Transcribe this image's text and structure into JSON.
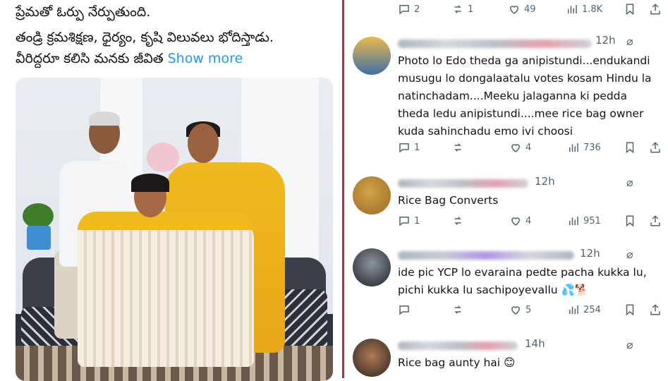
{
  "post": {
    "line1": "ప్రేమతో ఓర్పు నేర్పుతుంది.",
    "line2": "తండ్రి క్రమశిక్షణ, ధైర్యం, కృషి విలువలు భోదిస్తాడు.",
    "line3": "వీరిద్దరూ కలిసి మనకు జీవిత",
    "show_more": "Show more",
    "photo_alt": "family photo on sofa"
  },
  "top_actions": {
    "replies": "2",
    "reposts": "1",
    "likes": "49",
    "views": "1.8K"
  },
  "replies": [
    {
      "time": "12h",
      "text": "Photo lo Edo theda ga anipistundi...endukandi musugu lo dongalaatalu votes kosam Hindu la natinchadam....Meeku jalaganna ki pedda theda ledu anipistundi....mee rice bag owner kuda sahinchadu emo ivi choosi",
      "stats": {
        "replies": "1",
        "reposts": "",
        "likes": "4",
        "views": "736"
      }
    },
    {
      "time": "12h",
      "text": "Rice Bag Converts",
      "stats": {
        "replies": "1",
        "reposts": "",
        "likes": "4",
        "views": "951"
      }
    },
    {
      "time": "12h",
      "text": "ide pic YCP lo evaraina pedte pacha kukka lu, pichi kukka lu sachipoyevallu 💦🐕",
      "stats": {
        "replies": "",
        "reposts": "",
        "likes": "5",
        "views": "254"
      }
    },
    {
      "time": "14h",
      "text": "Rice bag aunty hai 😊",
      "stats": {
        "replies": "",
        "reposts": "",
        "likes": "",
        "views": ""
      }
    }
  ],
  "icons": {
    "reply": "speech-bubble-icon",
    "repost": "repost-arrows-icon",
    "like": "heart-icon",
    "views": "bar-chart-icon",
    "bookmark": "bookmark-icon",
    "share": "share-upload-icon",
    "more": "grok-slash-circle-icon"
  },
  "colors": {
    "divider": "#d8202a",
    "link": "#1d9bf0",
    "muted": "#536471"
  }
}
